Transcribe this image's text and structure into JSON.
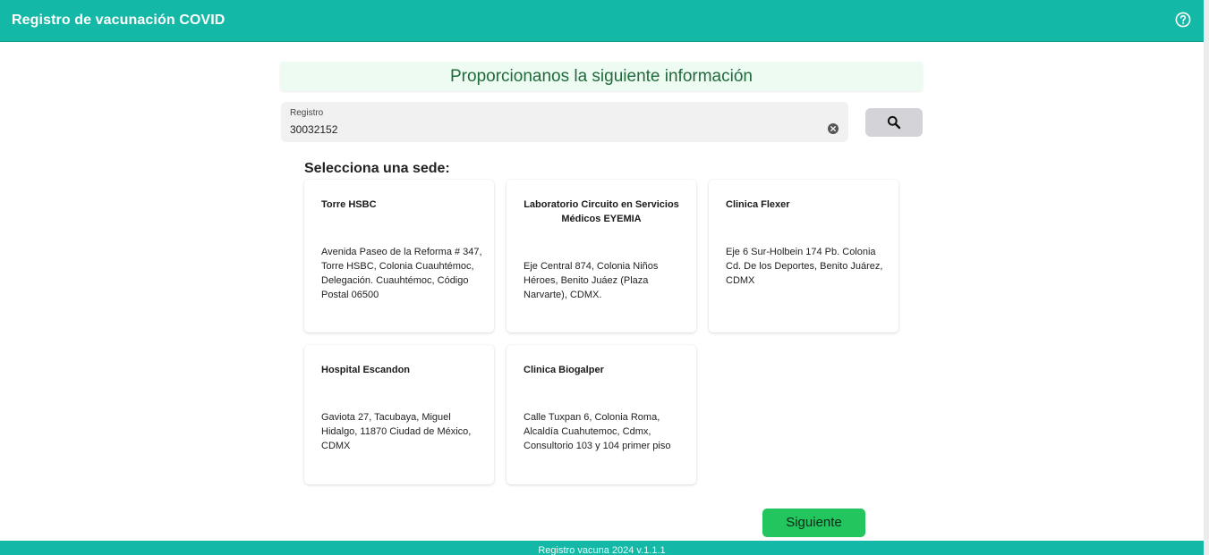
{
  "header": {
    "title": "Registro de vacunación COVID",
    "help_icon": "help-circle-icon"
  },
  "banner": {
    "text": "Proporcionanos la siguiente información"
  },
  "registro": {
    "label": "Registro",
    "value": "30032152",
    "clear_icon": "clear-circle-icon",
    "search_icon": "search-icon"
  },
  "sedes": {
    "title": "Selecciona una sede:",
    "items": [
      {
        "name": "Torre HSBC",
        "address": "Avenida Paseo de la Reforma # 347, Torre HSBC, Colonia Cuauhtémoc, Delegación. Cuauhtémoc, Código Postal 06500"
      },
      {
        "name": "Laboratorio Circuito en Servicios Médicos EYEMIA",
        "address": "Eje Central 874, Colonia Niños Héroes, Benito Juáez (Plaza Narvarte), CDMX."
      },
      {
        "name": "Clinica Flexer",
        "address": "Eje 6 Sur-Holbein 174 Pb. Colonia Cd. De los Deportes, Benito Juárez, CDMX"
      },
      {
        "name": "Hospital Escandon",
        "address": "Gaviota 27, Tacubaya, Miguel Hidalgo, 11870 Ciudad de México, CDMX"
      },
      {
        "name": "Clinica Biogalper",
        "address": "Calle Tuxpan 6, Colonia Roma, Alcaldía Cuahutemoc, Cdmx, Consultorio 103 y 104 primer piso"
      }
    ]
  },
  "actions": {
    "next_label": "Siguiente"
  },
  "footer": {
    "text": "Registro vacuna 2024 v.1.1.1"
  },
  "colors": {
    "header": "#14b8a6",
    "banner_bg": "#eefbf3",
    "banner_text": "#1f6b3a",
    "next_button": "#22c55e",
    "search_button": "#d4d4d8"
  }
}
